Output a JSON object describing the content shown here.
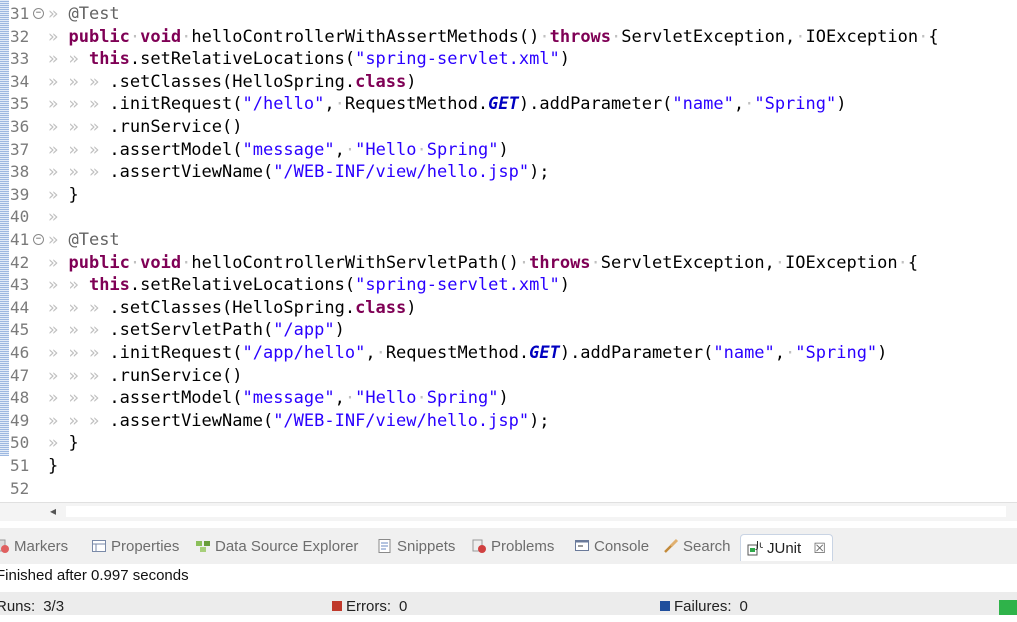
{
  "editor": {
    "lines": [
      {
        "n": "31",
        "fold": true,
        "ind": "» ",
        "segs": [
          [
            "ann",
            "@Test"
          ]
        ]
      },
      {
        "n": "32",
        "ind": "» ",
        "segs": [
          [
            "kw",
            "public"
          ],
          [
            "ws",
            "·"
          ],
          [
            "kw",
            "void"
          ],
          [
            "ws",
            "·"
          ],
          [
            "plain",
            "helloControllerWithAssertMethods()"
          ],
          [
            "ws",
            "·"
          ],
          [
            "kw",
            "throws"
          ],
          [
            "ws",
            "·"
          ],
          [
            "plain",
            "ServletException,"
          ],
          [
            "ws",
            "·"
          ],
          [
            "plain",
            "IOException"
          ],
          [
            "ws",
            "·"
          ],
          [
            "plain",
            "{"
          ]
        ]
      },
      {
        "n": "33",
        "ind": "» » ",
        "segs": [
          [
            "kw",
            "this"
          ],
          [
            "plain",
            ".setRelativeLocations("
          ],
          [
            "str",
            "\"spring-servlet.xml\""
          ],
          [
            "plain",
            ")"
          ]
        ]
      },
      {
        "n": "34",
        "ind": "» » » ",
        "segs": [
          [
            "plain",
            ".setClasses(HelloSpring."
          ],
          [
            "kw",
            "class"
          ],
          [
            "plain",
            ")"
          ]
        ]
      },
      {
        "n": "35",
        "ind": "» » » ",
        "segs": [
          [
            "plain",
            ".initRequest("
          ],
          [
            "str",
            "\"/hello\""
          ],
          [
            "plain",
            ","
          ],
          [
            "ws",
            "·"
          ],
          [
            "plain",
            "RequestMethod."
          ],
          [
            "const",
            "GET"
          ],
          [
            "plain",
            ").addParameter("
          ],
          [
            "str",
            "\"name\""
          ],
          [
            "plain",
            ","
          ],
          [
            "ws",
            "·"
          ],
          [
            "str",
            "\"Spring\""
          ],
          [
            "plain",
            ")"
          ]
        ]
      },
      {
        "n": "36",
        "ind": "» » » ",
        "segs": [
          [
            "plain",
            ".runService()"
          ]
        ]
      },
      {
        "n": "37",
        "ind": "» » » ",
        "segs": [
          [
            "plain",
            ".assertModel("
          ],
          [
            "str",
            "\"message\""
          ],
          [
            "plain",
            ","
          ],
          [
            "ws",
            "·"
          ],
          [
            "str",
            "\"Hello"
          ],
          [
            "ws",
            "·"
          ],
          [
            "str",
            "Spring\""
          ],
          [
            "plain",
            ")"
          ]
        ]
      },
      {
        "n": "38",
        "ind": "» » » ",
        "segs": [
          [
            "plain",
            ".assertViewName("
          ],
          [
            "str",
            "\"/WEB-INF/view/hello.jsp\""
          ],
          [
            "plain",
            ");"
          ]
        ]
      },
      {
        "n": "39",
        "ind": "» ",
        "segs": [
          [
            "plain",
            "}"
          ]
        ]
      },
      {
        "n": "40",
        "ind": "» ",
        "segs": []
      },
      {
        "n": "41",
        "fold": true,
        "ind": "» ",
        "segs": [
          [
            "ann",
            "@Test"
          ]
        ]
      },
      {
        "n": "42",
        "ind": "» ",
        "segs": [
          [
            "kw",
            "public"
          ],
          [
            "ws",
            "·"
          ],
          [
            "kw",
            "void"
          ],
          [
            "ws",
            "·"
          ],
          [
            "plain",
            "helloControllerWithServletPath()"
          ],
          [
            "ws",
            "·"
          ],
          [
            "kw",
            "throws"
          ],
          [
            "ws",
            "·"
          ],
          [
            "plain",
            "ServletException,"
          ],
          [
            "ws",
            "·"
          ],
          [
            "plain",
            "IOException"
          ],
          [
            "ws",
            "·"
          ],
          [
            "plain",
            "{"
          ]
        ]
      },
      {
        "n": "43",
        "ind": "» » ",
        "segs": [
          [
            "kw",
            "this"
          ],
          [
            "plain",
            ".setRelativeLocations("
          ],
          [
            "str",
            "\"spring-servlet.xml\""
          ],
          [
            "plain",
            ")"
          ]
        ]
      },
      {
        "n": "44",
        "ind": "» » » ",
        "segs": [
          [
            "plain",
            ".setClasses(HelloSpring."
          ],
          [
            "kw",
            "class"
          ],
          [
            "plain",
            ")"
          ]
        ]
      },
      {
        "n": "45",
        "ind": "» » » ",
        "segs": [
          [
            "plain",
            ".setServletPath("
          ],
          [
            "str",
            "\"/app\""
          ],
          [
            "plain",
            ")"
          ]
        ]
      },
      {
        "n": "46",
        "ind": "» » » ",
        "segs": [
          [
            "plain",
            ".initRequest("
          ],
          [
            "str",
            "\"/app/hello\""
          ],
          [
            "plain",
            ","
          ],
          [
            "ws",
            "·"
          ],
          [
            "plain",
            "RequestMethod."
          ],
          [
            "const",
            "GET"
          ],
          [
            "plain",
            ").addParameter("
          ],
          [
            "str",
            "\"name\""
          ],
          [
            "plain",
            ","
          ],
          [
            "ws",
            "·"
          ],
          [
            "str",
            "\"Spring\""
          ],
          [
            "plain",
            ")"
          ]
        ]
      },
      {
        "n": "47",
        "ind": "» » » ",
        "segs": [
          [
            "plain",
            ".runService()"
          ]
        ]
      },
      {
        "n": "48",
        "ind": "» » » ",
        "segs": [
          [
            "plain",
            ".assertModel("
          ],
          [
            "str",
            "\"message\""
          ],
          [
            "plain",
            ","
          ],
          [
            "ws",
            "·"
          ],
          [
            "str",
            "\"Hello"
          ],
          [
            "ws",
            "·"
          ],
          [
            "str",
            "Spring\""
          ],
          [
            "plain",
            ")"
          ]
        ]
      },
      {
        "n": "49",
        "ind": "» » » ",
        "segs": [
          [
            "plain",
            ".assertViewName("
          ],
          [
            "str",
            "\"/WEB-INF/view/hello.jsp\""
          ],
          [
            "plain",
            ");"
          ]
        ]
      },
      {
        "n": "50",
        "ind": "» ",
        "segs": [
          [
            "plain",
            "}"
          ]
        ]
      },
      {
        "n": "51",
        "ind": "",
        "segs": [
          [
            "plain",
            "}"
          ]
        ]
      },
      {
        "n": "52",
        "ind": "",
        "segs": []
      }
    ],
    "fold_glyph": "⊖",
    "scroll_left_arrow": "◂"
  },
  "views": {
    "tabs": [
      {
        "key": "markers",
        "label": "Markers",
        "icon": "markers-icon"
      },
      {
        "key": "properties",
        "label": "Properties",
        "icon": "properties-icon"
      },
      {
        "key": "datasource",
        "label": "Data Source Explorer",
        "icon": "data-source-explorer-icon"
      },
      {
        "key": "snippets",
        "label": "Snippets",
        "icon": "snippets-icon"
      },
      {
        "key": "problems",
        "label": "Problems",
        "icon": "problems-icon"
      },
      {
        "key": "console",
        "label": "Console",
        "icon": "console-icon"
      },
      {
        "key": "search",
        "label": "Search",
        "icon": "search-icon"
      },
      {
        "key": "junit",
        "label": "JUnit",
        "icon": "junit-icon",
        "active": true,
        "close": "☒"
      }
    ]
  },
  "junit": {
    "status": "Finished after 0.997 seconds",
    "runs_label": "Runs:",
    "runs_value": "3/3",
    "errors_label": "Errors:",
    "errors_value": "0",
    "failures_label": "Failures:",
    "failures_value": "0",
    "success_color": "#2fb34a",
    "error_color": "#c0392b",
    "failure_color": "#1f4e9c"
  }
}
